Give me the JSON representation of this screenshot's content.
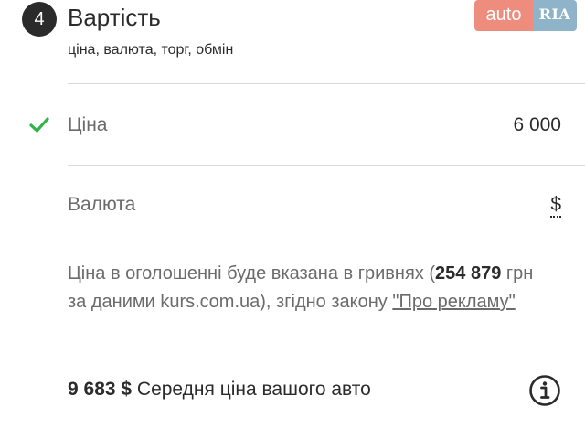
{
  "section": {
    "step_number": "4",
    "title": "Вартість",
    "subtitle": "ціна, валюта, торг, обмін"
  },
  "logo": {
    "left_text": "auto",
    "right_text": "RIA"
  },
  "price_row": {
    "label": "Ціна",
    "value": "6 000",
    "status_icon": "check-icon",
    "status_color": "#2db34a"
  },
  "currency_row": {
    "label": "Валюта",
    "value": "$"
  },
  "info": {
    "text_before": "Ціна в оголошенні буде вказана в гривнях (",
    "uah_amount": "254 879",
    "text_middle": " грн за даними kurs.com.ua), згідно закону ",
    "link_text": "\"Про рекламу\""
  },
  "average": {
    "amount": "9 683 $",
    "label": " Середня ціна вашого авто",
    "icon": "info-icon"
  }
}
